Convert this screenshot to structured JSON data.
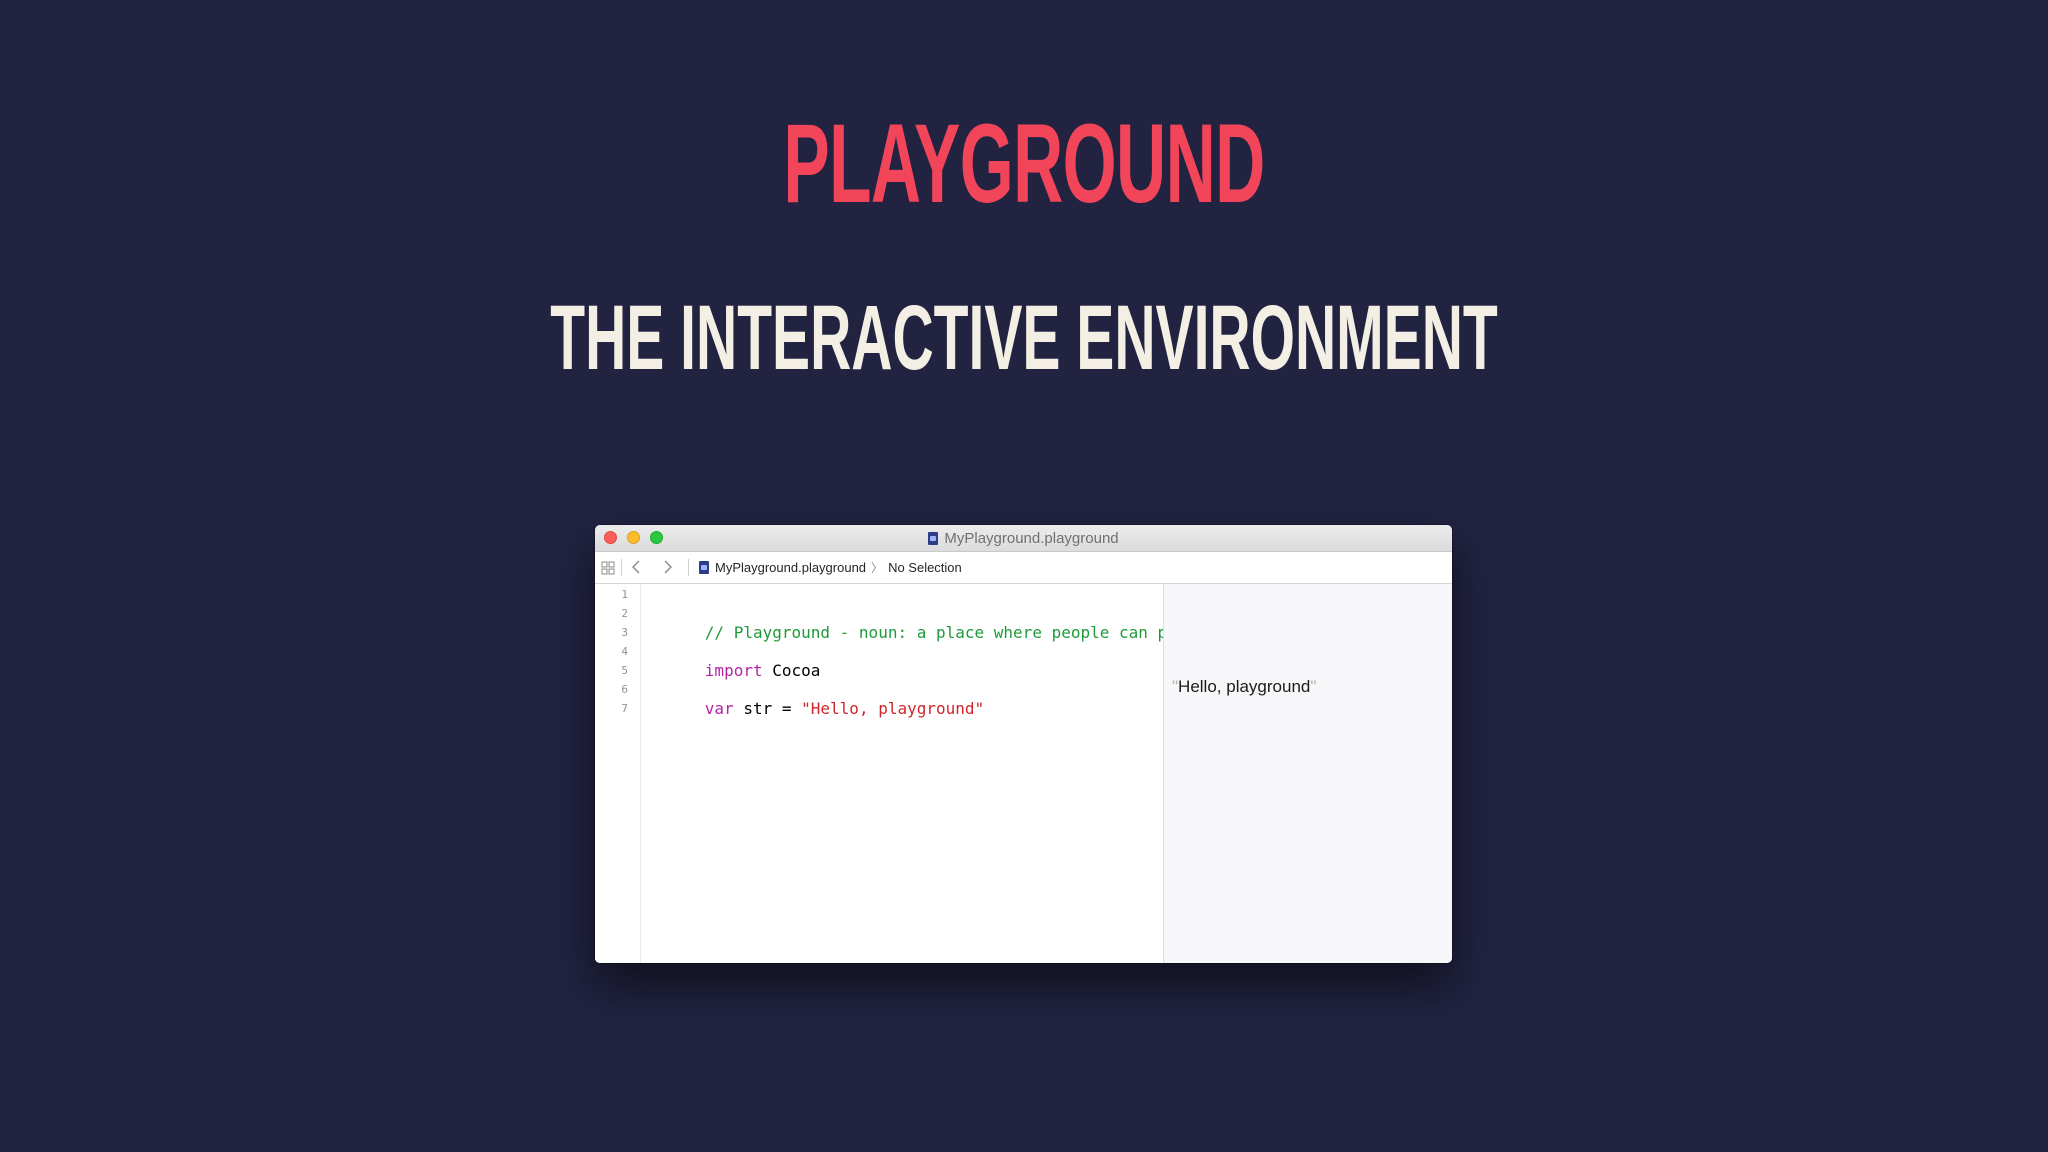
{
  "slide": {
    "title": "PLAYGROUND",
    "subtitle": "THE INTERACTIVE ENVIRONMENT"
  },
  "window": {
    "title": "MyPlayground.playground",
    "traffic_colors": {
      "close": "#fc5f57",
      "minimize": "#fdbc2e",
      "zoom": "#29c840"
    }
  },
  "toolbar": {
    "grid_icon": "grid-icon",
    "back_icon": "chevron-left-icon",
    "forward_icon": "chevron-right-icon",
    "breadcrumb": {
      "file": "MyPlayground.playground",
      "separator": "〉",
      "selection": "No Selection"
    }
  },
  "editor": {
    "line_numbers": [
      "1",
      "2",
      "3",
      "4",
      "5",
      "6",
      "7"
    ],
    "lines": {
      "comment": "// Playground - noun: a place where people can play",
      "import_keyword": "import",
      "import_module": " Cocoa",
      "var_keyword": "var",
      "var_decl": " str = ",
      "var_value": "\"Hello, playground\""
    },
    "colors": {
      "comment": "#1f9a3a",
      "keyword": "#b526a4",
      "string": "#d0252a"
    }
  },
  "results": {
    "quote_open": "\"",
    "value": "Hello, playground",
    "quote_close": "\""
  },
  "colors": {
    "background": "#212341",
    "title": "#f2455a",
    "subtitle": "#f4efe4"
  }
}
